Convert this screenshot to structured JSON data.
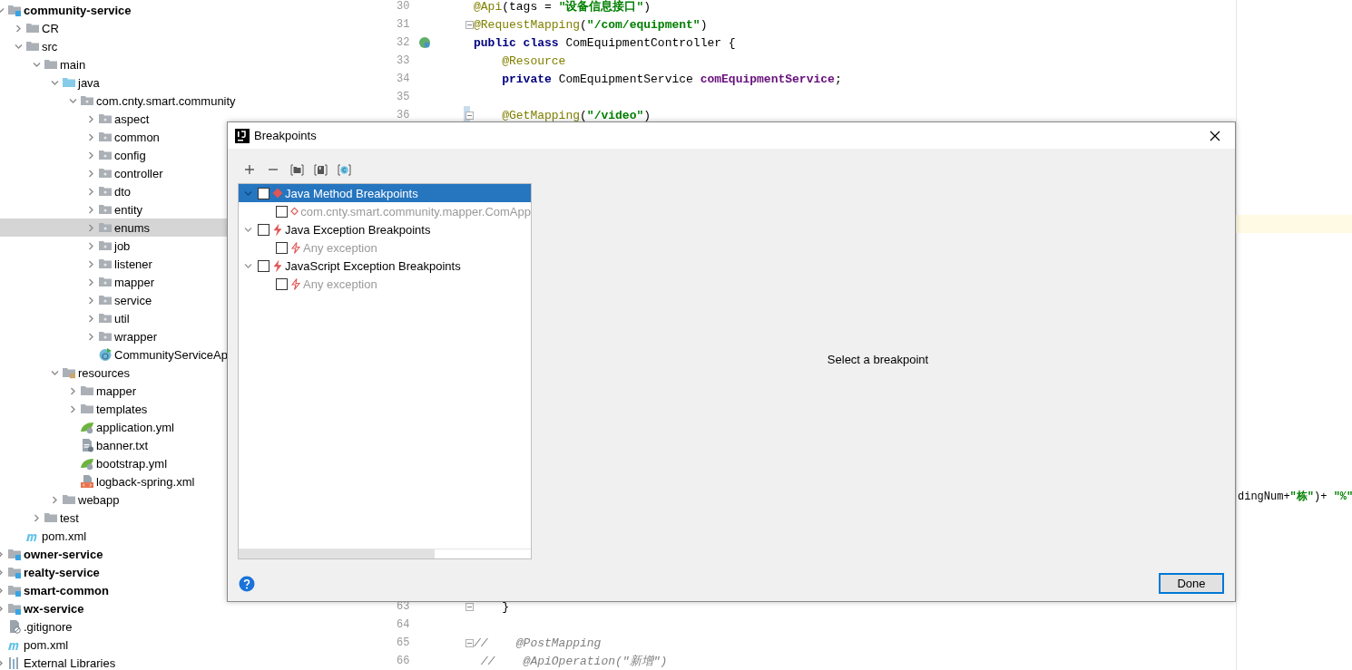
{
  "project_tree": [
    {
      "label": "community-service",
      "kind": "module",
      "expanded": true,
      "selected": false,
      "children": [
        {
          "label": "CR",
          "kind": "folder",
          "expanded": false,
          "selected": false
        },
        {
          "label": "src",
          "kind": "folder",
          "expanded": true,
          "selected": false,
          "children": [
            {
              "label": "main",
              "kind": "folder",
              "expanded": true,
              "selected": false,
              "children": [
                {
                  "label": "java",
                  "kind": "source",
                  "expanded": true,
                  "selected": false,
                  "children": [
                    {
                      "label": "com.cnty.smart.community",
                      "kind": "package",
                      "expanded": true,
                      "selected": false,
                      "children": [
                        {
                          "label": "aspect",
                          "kind": "package",
                          "expanded": false,
                          "selected": false
                        },
                        {
                          "label": "common",
                          "kind": "package",
                          "expanded": false,
                          "selected": false
                        },
                        {
                          "label": "config",
                          "kind": "package",
                          "expanded": false,
                          "selected": false
                        },
                        {
                          "label": "controller",
                          "kind": "package",
                          "expanded": false,
                          "selected": false
                        },
                        {
                          "label": "dto",
                          "kind": "package",
                          "expanded": false,
                          "selected": false
                        },
                        {
                          "label": "entity",
                          "kind": "package",
                          "expanded": false,
                          "selected": false
                        },
                        {
                          "label": "enums",
                          "kind": "package",
                          "expanded": false,
                          "selected": true
                        },
                        {
                          "label": "job",
                          "kind": "package",
                          "expanded": false,
                          "selected": false
                        },
                        {
                          "label": "listener",
                          "kind": "package",
                          "expanded": false,
                          "selected": false
                        },
                        {
                          "label": "mapper",
                          "kind": "package",
                          "expanded": false,
                          "selected": false
                        },
                        {
                          "label": "service",
                          "kind": "package",
                          "expanded": false,
                          "selected": false
                        },
                        {
                          "label": "util",
                          "kind": "package",
                          "expanded": false,
                          "selected": false
                        },
                        {
                          "label": "wrapper",
                          "kind": "package",
                          "expanded": false,
                          "selected": false
                        },
                        {
                          "label": "CommunityServiceAp",
                          "kind": "app-class",
                          "selected": false
                        }
                      ]
                    }
                  ]
                },
                {
                  "label": "resources",
                  "kind": "resources",
                  "expanded": true,
                  "selected": false,
                  "children": [
                    {
                      "label": "mapper",
                      "kind": "folder",
                      "expanded": false,
                      "selected": false
                    },
                    {
                      "label": "templates",
                      "kind": "folder",
                      "expanded": false,
                      "selected": false
                    },
                    {
                      "label": "application.yml",
                      "kind": "spring-yml",
                      "selected": false
                    },
                    {
                      "label": "banner.txt",
                      "kind": "text",
                      "selected": false
                    },
                    {
                      "label": "bootstrap.yml",
                      "kind": "spring-yml",
                      "selected": false
                    },
                    {
                      "label": "logback-spring.xml",
                      "kind": "xml",
                      "selected": false
                    }
                  ]
                },
                {
                  "label": "webapp",
                  "kind": "folder",
                  "expanded": false,
                  "selected": false
                }
              ]
            },
            {
              "label": "test",
              "kind": "folder",
              "expanded": false,
              "selected": false
            }
          ]
        },
        {
          "label": "pom.xml",
          "kind": "maven",
          "selected": false
        }
      ]
    },
    {
      "label": "owner-service",
      "kind": "module",
      "expanded": false,
      "selected": false
    },
    {
      "label": "realty-service",
      "kind": "module",
      "expanded": false,
      "selected": false
    },
    {
      "label": "smart-common",
      "kind": "module",
      "expanded": false,
      "selected": false
    },
    {
      "label": "wx-service",
      "kind": "module",
      "expanded": false,
      "selected": false
    },
    {
      "label": ".gitignore",
      "kind": "ignore",
      "selected": false
    },
    {
      "label": "pom.xml",
      "kind": "maven",
      "selected": false
    },
    {
      "label": "External Libraries",
      "kind": "libraries",
      "expanded": false,
      "selected": false
    }
  ],
  "editor": {
    "lines_top": [
      {
        "number": "30",
        "fold": false,
        "changed": false,
        "tokens": [
          {
            "kind": "annotation",
            "text": "@Api"
          },
          {
            "kind": "plain",
            "text": "(tags = "
          },
          {
            "kind": "string",
            "text": "\"设备信息接口\""
          },
          {
            "kind": "plain",
            "text": ")"
          }
        ]
      },
      {
        "number": "31",
        "fold": true,
        "changed": false,
        "tokens": [
          {
            "kind": "annotation",
            "text": "@RequestMapping"
          },
          {
            "kind": "plain",
            "text": "("
          },
          {
            "kind": "string",
            "text": "\"/com/equipment\""
          },
          {
            "kind": "plain",
            "text": ")"
          }
        ]
      },
      {
        "number": "32",
        "fold": false,
        "changed": false,
        "marker": true,
        "tokens": [
          {
            "kind": "keyword",
            "text": "public class"
          },
          {
            "kind": "plain",
            "text": " ComEquipmentController {"
          }
        ]
      },
      {
        "number": "33",
        "fold": false,
        "changed": false,
        "tokens": [
          {
            "kind": "annotation",
            "text": "    @Resource"
          }
        ]
      },
      {
        "number": "34",
        "fold": false,
        "changed": false,
        "tokens": [
          {
            "kind": "keyword",
            "text": "    private"
          },
          {
            "kind": "plain",
            "text": " ComEquipmentService "
          },
          {
            "kind": "field",
            "text": "comEquipmentService"
          },
          {
            "kind": "plain",
            "text": ";"
          }
        ]
      },
      {
        "number": "35",
        "fold": false,
        "changed": false
      },
      {
        "number": "36",
        "fold": true,
        "changed": true,
        "tokens": [
          {
            "kind": "annotation",
            "text": "    @GetMapping"
          },
          {
            "kind": "plain",
            "text": "("
          },
          {
            "kind": "string",
            "text": "\"/video\""
          },
          {
            "kind": "plain",
            "text": ")"
          }
        ]
      }
    ],
    "current_line_highlight": true,
    "partial_line": {
      "tokens": [
        {
          "kind": "plain",
          "text": "dingNum+"
        },
        {
          "kind": "string",
          "text": "\"栋\""
        },
        {
          "kind": "plain",
          "text": ")+ "
        },
        {
          "kind": "string",
          "text": "\"%\""
        }
      ]
    },
    "lines_bottom": [
      {
        "number": "63",
        "fold": true,
        "changed": false,
        "tokens": [
          {
            "kind": "plain",
            "text": "    }"
          }
        ]
      },
      {
        "number": "64",
        "fold": false,
        "changed": false
      },
      {
        "number": "65",
        "fold": true,
        "changed": false,
        "tokens": [
          {
            "kind": "comment",
            "text": "//    @PostMapping"
          }
        ]
      },
      {
        "number": "66",
        "fold": false,
        "changed": false,
        "tokens": [
          {
            "kind": "comment",
            "text": " //    @ApiOperation(\"新增\")"
          }
        ]
      }
    ]
  },
  "dialog": {
    "title": "Breakpoints",
    "toolbar": [
      {
        "kind": "add"
      },
      {
        "kind": "remove"
      },
      {
        "kind": "group-package"
      },
      {
        "kind": "group-file"
      },
      {
        "kind": "group-class"
      }
    ],
    "breakpoints": [
      {
        "label": "Java Method Breakpoints",
        "kind": "method",
        "checked": false,
        "selected": true,
        "expanded": true,
        "disabled": false,
        "children": [
          {
            "label": "com.cnty.smart.community.mapper.ComApp",
            "kind": "method",
            "checked": false,
            "selected": false,
            "disabled": true
          }
        ]
      },
      {
        "label": "Java Exception Breakpoints",
        "kind": "exception",
        "checked": false,
        "selected": false,
        "expanded": true,
        "disabled": false,
        "children": [
          {
            "label": "Any exception",
            "kind": "exception",
            "checked": false,
            "selected": false,
            "disabled": true
          }
        ]
      },
      {
        "label": "JavaScript Exception Breakpoints",
        "kind": "exception",
        "checked": false,
        "selected": false,
        "expanded": true,
        "disabled": false,
        "children": [
          {
            "label": "Any exception",
            "kind": "exception",
            "checked": false,
            "selected": false,
            "disabled": true
          }
        ]
      }
    ],
    "detail_message": "Select a breakpoint",
    "done_button": "Done"
  }
}
